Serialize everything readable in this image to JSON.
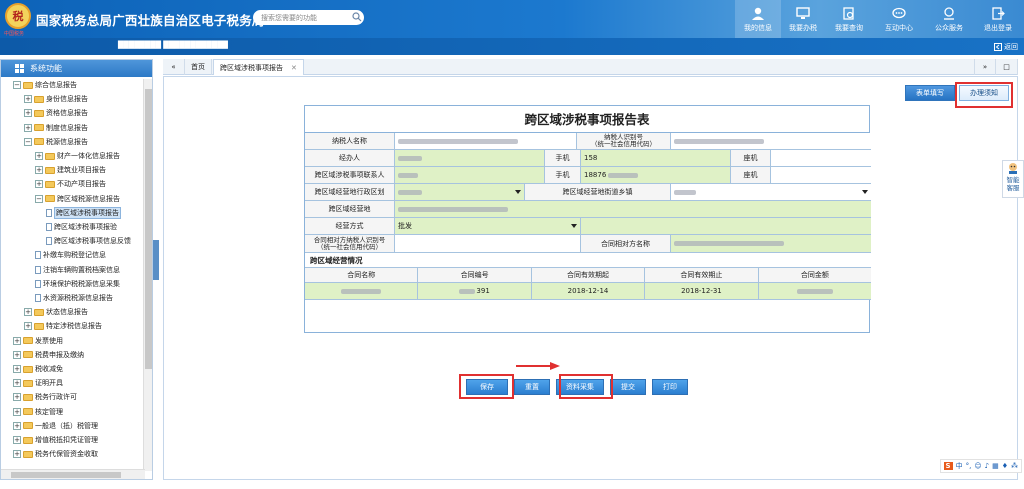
{
  "header": {
    "logo_text": "税",
    "logo_sub": "中国税务",
    "title": "国家税务总局广西壮族自治区电子税务局",
    "search_placeholder": "搜索您需要的功能",
    "nav": [
      {
        "label": "我的信息",
        "icon": "user-icon"
      },
      {
        "label": "我要办税",
        "icon": "monitor-icon"
      },
      {
        "label": "我要查询",
        "icon": "query-icon"
      },
      {
        "label": "互动中心",
        "icon": "chat-icon"
      },
      {
        "label": "公众服务",
        "icon": "service-icon"
      },
      {
        "label": "退出登录",
        "icon": "logout-icon"
      }
    ]
  },
  "subbar": {
    "user_info": "████████ ████████████",
    "back_label": "返回"
  },
  "sidebar": {
    "title": "系统功能",
    "items": [
      {
        "label": "综合信息报告",
        "level": 0,
        "kind": "folder",
        "toggle": "−"
      },
      {
        "label": "身份信息报告",
        "level": 1,
        "kind": "folder",
        "toggle": "+"
      },
      {
        "label": "资格信息报告",
        "level": 1,
        "kind": "folder",
        "toggle": "+"
      },
      {
        "label": "制度信息报告",
        "level": 1,
        "kind": "folder",
        "toggle": "+"
      },
      {
        "label": "税源信息报告",
        "level": 1,
        "kind": "folder",
        "toggle": "−"
      },
      {
        "label": "财产一体化信息报告",
        "level": 2,
        "kind": "folder",
        "toggle": "+"
      },
      {
        "label": "建筑业项目报告",
        "level": 2,
        "kind": "folder",
        "toggle": "+"
      },
      {
        "label": "不动产项目报告",
        "level": 2,
        "kind": "folder",
        "toggle": "+"
      },
      {
        "label": "跨区域税源信息报告",
        "level": 2,
        "kind": "folder",
        "toggle": "−"
      },
      {
        "label": "跨区域涉税事项报告",
        "level": 3,
        "kind": "doc",
        "selected": true
      },
      {
        "label": "跨区域涉税事项报验",
        "level": 3,
        "kind": "doc"
      },
      {
        "label": "跨区域涉税事项信息反馈",
        "level": 3,
        "kind": "doc"
      },
      {
        "label": "补缴车购税登记信息",
        "level": 2,
        "kind": "doc"
      },
      {
        "label": "注销车辆购置税档案信息",
        "level": 2,
        "kind": "doc"
      },
      {
        "label": "环境保护税税源信息采集",
        "level": 2,
        "kind": "doc"
      },
      {
        "label": "水资源税税源信息报告",
        "level": 2,
        "kind": "doc"
      },
      {
        "label": "状态信息报告",
        "level": 1,
        "kind": "folder",
        "toggle": "+"
      },
      {
        "label": "特定涉税信息报告",
        "level": 1,
        "kind": "folder",
        "toggle": "+"
      },
      {
        "label": "发票使用",
        "level": 0,
        "kind": "folder",
        "toggle": "+"
      },
      {
        "label": "税费申报及缴纳",
        "level": 0,
        "kind": "folder",
        "toggle": "+"
      },
      {
        "label": "税收减免",
        "level": 0,
        "kind": "folder",
        "toggle": "+"
      },
      {
        "label": "证明开具",
        "level": 0,
        "kind": "folder",
        "toggle": "+"
      },
      {
        "label": "税务行政许可",
        "level": 0,
        "kind": "folder",
        "toggle": "+"
      },
      {
        "label": "核定管理",
        "level": 0,
        "kind": "folder",
        "toggle": "+"
      },
      {
        "label": "一般退（抵）税管理",
        "level": 0,
        "kind": "folder",
        "toggle": "+"
      },
      {
        "label": "增值税抵扣凭证管理",
        "level": 0,
        "kind": "folder",
        "toggle": "+"
      },
      {
        "label": "税务代保管资金收取",
        "level": 0,
        "kind": "folder",
        "toggle": "+"
      }
    ]
  },
  "tabs": {
    "home": "首页",
    "current": "跨区域涉税事项报告"
  },
  "content_tabs": {
    "form_fill": "表单填写",
    "guide": "办理须知"
  },
  "form": {
    "title": "跨区域涉税事项报告表",
    "labels": {
      "taxpayer_name": "纳税人名称",
      "taxpayer_id": "纳税人识别号\n（统一社会信用代码）",
      "handler": "经办人",
      "mobile": "手机",
      "landline": "座机",
      "cross_contact": "跨区域涉税事项联系人",
      "cross_region": "跨区域经营地行政区划",
      "cross_street": "跨区域经营地街道乡镇",
      "cross_address": "跨区域经营地",
      "mode": "经营方式",
      "partner_id": "合同相对方纳税人识别号\n（统一社会信用代码）",
      "partner_name": "合同相对方名称"
    },
    "values": {
      "handler_mobile_prefix": "158",
      "contact_mobile_prefix": "18876",
      "mode": "批发"
    },
    "section": "跨区域经营情况",
    "contract_columns": [
      "合同名称",
      "合同编号",
      "合同有效期起",
      "合同有效期止",
      "合同金额"
    ],
    "contract_rows": [
      {
        "name": "",
        "number": "391",
        "start": "2018-12-14",
        "end": "2018-12-31",
        "amount": ""
      }
    ]
  },
  "buttons": [
    "保存",
    "重置",
    "资料采集",
    "提交",
    "打印"
  ],
  "smart_label": "智能客服",
  "ime": {
    "logo": "S",
    "lang": "中"
  }
}
